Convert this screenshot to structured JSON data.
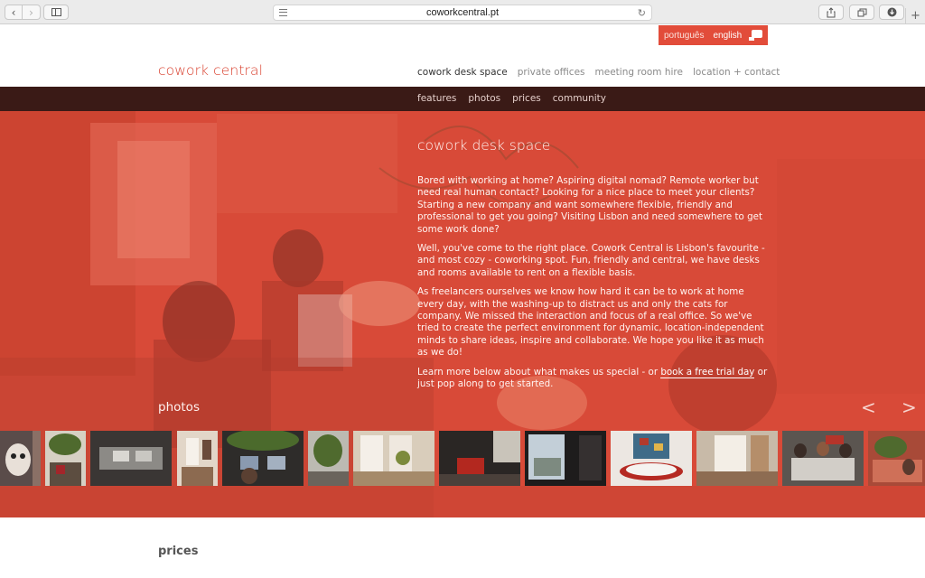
{
  "browser": {
    "url": "coworkcentral.pt",
    "back_glyph": "‹",
    "forward_glyph": "›",
    "reload_glyph": "↻",
    "new_tab_glyph": "+",
    "icons": [
      "chevron-left-icon",
      "chevron-right-icon",
      "sidebar-icon",
      "reader-icon",
      "reload-icon",
      "share-icon",
      "tabs-icon",
      "download-icon",
      "new-tab-icon"
    ]
  },
  "language": {
    "options": [
      "português",
      "english"
    ],
    "active": "english",
    "icon": "chat-icon"
  },
  "header": {
    "logo": "cowork central",
    "nav": [
      "cowork desk space",
      "private offices",
      "meeting room hire",
      "location + contact"
    ],
    "active_nav": "cowork desk space"
  },
  "subnav": [
    "features",
    "photos",
    "prices",
    "community"
  ],
  "hero": {
    "title": "cowork desk space",
    "paragraphs": [
      "Bored with working at home? Aspiring digital nomad? Remote worker but need real human contact? Looking for a nice place to meet your clients? Starting a new company and want somewhere flexible, friendly and professional to get you going? Visiting Lisbon and need somewhere to get some work done?",
      "Well, you've come to the right place. Cowork Central is Lisbon's favourite - and most cozy - coworking spot. Fun, friendly and central, we have desks and rooms available to rent on a flexible basis.",
      "As freelancers ourselves we know how hard it can be to work at home every day, with the washing-up to distract us and only the cats for company. We missed the interaction and focus of a real office. So we've tried to create the perfect environment for dynamic, location-independent minds to share ideas, inspire and collaborate. We hope you like it as much as we do!"
    ],
    "last_paragraph": {
      "before": "Learn more below about what makes us special - or ",
      "link": "book a free trial day",
      "after": " or just pop along to get started."
    }
  },
  "photos": {
    "label": "photos",
    "prev": "<",
    "next": ">",
    "thumbnails": [
      "dog",
      "office-plants",
      "office-desks",
      "window-room",
      "office-workers",
      "plant-corner",
      "window-table",
      "red-chairs",
      "window-view",
      "tile-wall-table",
      "window-shutters",
      "team-table",
      "office-overview"
    ]
  },
  "section": {
    "prices_title": "prices"
  },
  "colors": {
    "brand_red": "#d9402e",
    "lang_bar": "#e24c3a",
    "subnav_bg": "#3a1a16",
    "hero_overlay": "#d84a38"
  }
}
